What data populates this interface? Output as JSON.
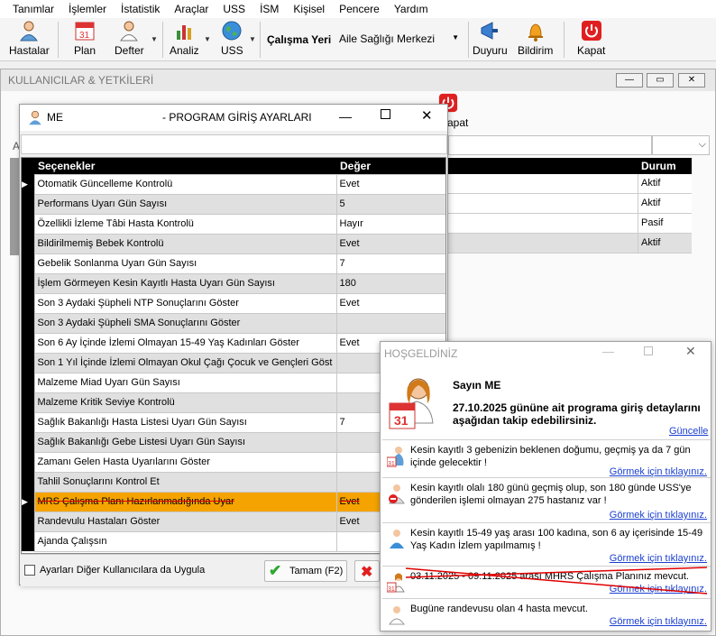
{
  "menu": [
    "Tanımlar",
    "İşlemler",
    "İstatistik",
    "Araçlar",
    "USS",
    "İSM",
    "Kişisel",
    "Pencere",
    "Yardım"
  ],
  "toolbar": {
    "hastalar": "Hastalar",
    "plan": "Plan",
    "defter": "Defter",
    "analiz": "Analiz",
    "uss": "USS",
    "workplace_label": "Çalışma Yeri",
    "workplace_value": "Aile Sağlığı Merkezi",
    "duyuru": "Duyuru",
    "bildirim": "Bildirim",
    "kapat": "Kapat"
  },
  "bg_window": {
    "title": "KULLANICILAR & YETKİLERİ",
    "left_letter": "A",
    "kapat_partial": "apat",
    "col_durum": "Durum",
    "durum_values": [
      "Aktif",
      "Aktif",
      "Pasif",
      "Aktif"
    ]
  },
  "dialog": {
    "title_user": "ME",
    "title_text": "- PROGRAM GİRİŞ AYARLARI",
    "col_option": "Seçenekler",
    "col_value": "Değer",
    "rows": [
      {
        "label": "Otomatik Güncelleme Kontrolü",
        "value": "Evet"
      },
      {
        "label": "Performans Uyarı Gün Sayısı",
        "value": "5"
      },
      {
        "label": "Özellikli İzleme Tâbi Hasta Kontrolü",
        "value": "Hayır"
      },
      {
        "label": "Bildirilmemiş Bebek Kontrolü",
        "value": "Evet"
      },
      {
        "label": "Gebelik Sonlanma Uyarı Gün Sayısı",
        "value": "7"
      },
      {
        "label": "İşlem Görmeyen Kesin Kayıtlı Hasta Uyarı Gün Sayısı",
        "value": "180"
      },
      {
        "label": "Son 3 Aydaki Şüpheli NTP Sonuçlarını Göster",
        "value": "Evet"
      },
      {
        "label": "Son 3 Aydaki Şüpheli SMA Sonuçlarını Göster",
        "value": ""
      },
      {
        "label": "Son 6 Ay İçinde İzlemi Olmayan 15-49 Yaş Kadınları Göster",
        "value": "Evet"
      },
      {
        "label": "Son 1 Yıl İçinde İzlemi Olmayan Okul Çağı Çocuk ve Gençleri Göst",
        "value": ""
      },
      {
        "label": "Malzeme Miad Uyarı Gün Sayısı",
        "value": ""
      },
      {
        "label": "Malzeme Kritik Seviye Kontrolü",
        "value": ""
      },
      {
        "label": "Sağlık Bakanlığı Hasta Listesi Uyarı Gün Sayısı",
        "value": "7"
      },
      {
        "label": "Sağlık Bakanlığı Gebe Listesi Uyarı Gün Sayısı",
        "value": ""
      },
      {
        "label": "Zamanı Gelen Hasta Uyarılarını Göster",
        "value": ""
      },
      {
        "label": "Tahlil Sonuçlarını Kontrol Et",
        "value": ""
      },
      {
        "label": "MRS Çalışma Planı Hazırlanmadığında Uyar",
        "value": "Evet"
      },
      {
        "label": "Randevulu Hastaları Göster",
        "value": "Evet"
      },
      {
        "label": "Ajanda Çalışsın",
        "value": ""
      }
    ],
    "apply_all_label": "Ayarları Diğer Kullanıcılara da Uygula",
    "ok_label": "Tamam (F2)"
  },
  "popup": {
    "title": "HOŞGELDİNİZ",
    "greeting": "Sayın ME",
    "info": "27.10.2025 gününe ait programa giriş detaylarını aşağıdan takip edebilirsiniz.",
    "refresh_link": "Güncelle",
    "notes": [
      {
        "text": "Kesin kayıtlı 3 gebenizin beklenen doğumu, geçmiş ya da 7 gün içinde gelecektir !",
        "link": "Görmek için tıklayınız."
      },
      {
        "text": "Kesin kayıtlı olalı 180 günü geçmiş olup, son 180 günde USS'ye gönderilen işlemi olmayan 275 hastanız var !",
        "link": "Görmek için tıklayınız."
      },
      {
        "text": "Kesin kayıtlı 15-49 yaş arası 100 kadına, son 6 ay içerisinde 15-49 Yaş Kadın İzlem yapılmamış !",
        "link": "Görmek için tıklayınız."
      },
      {
        "text": "03.11.2025 - 09.11.2025 arası MHRS Çalışma Planınız mevcut.",
        "link": "Görmek için tıklayınız."
      },
      {
        "text": "Bugüne randevusu olan 4 hasta mevcut.",
        "link": "Görmek için tıklayınız."
      }
    ]
  },
  "colors": {
    "selected_row": "#f5a300",
    "link": "#1a3fd0",
    "strike": "#e00000"
  }
}
